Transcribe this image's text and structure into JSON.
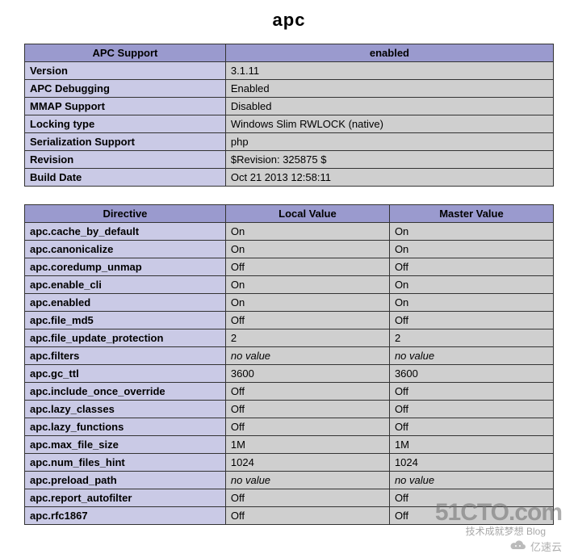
{
  "title": "apc",
  "support_table": {
    "header_left": "APC Support",
    "header_right": "enabled",
    "rows": [
      {
        "k": "Version",
        "v": "3.1.11"
      },
      {
        "k": "APC Debugging",
        "v": "Enabled"
      },
      {
        "k": "MMAP Support",
        "v": "Disabled"
      },
      {
        "k": "Locking type",
        "v": "Windows Slim RWLOCK (native)"
      },
      {
        "k": "Serialization Support",
        "v": "php"
      },
      {
        "k": "Revision",
        "v": "$Revision: 325875 $"
      },
      {
        "k": "Build Date",
        "v": "Oct 21 2013 12:58:11"
      }
    ]
  },
  "directives_table": {
    "headers": [
      "Directive",
      "Local Value",
      "Master Value"
    ],
    "rows": [
      {
        "d": "apc.cache_by_default",
        "l": "On",
        "m": "On"
      },
      {
        "d": "apc.canonicalize",
        "l": "On",
        "m": "On"
      },
      {
        "d": "apc.coredump_unmap",
        "l": "Off",
        "m": "Off"
      },
      {
        "d": "apc.enable_cli",
        "l": "On",
        "m": "On"
      },
      {
        "d": "apc.enabled",
        "l": "On",
        "m": "On"
      },
      {
        "d": "apc.file_md5",
        "l": "Off",
        "m": "Off"
      },
      {
        "d": "apc.file_update_protection",
        "l": "2",
        "m": "2"
      },
      {
        "d": "apc.filters",
        "l": "no value",
        "m": "no value",
        "nv": true
      },
      {
        "d": "apc.gc_ttl",
        "l": "3600",
        "m": "3600"
      },
      {
        "d": "apc.include_once_override",
        "l": "Off",
        "m": "Off"
      },
      {
        "d": "apc.lazy_classes",
        "l": "Off",
        "m": "Off"
      },
      {
        "d": "apc.lazy_functions",
        "l": "Off",
        "m": "Off"
      },
      {
        "d": "apc.max_file_size",
        "l": "1M",
        "m": "1M"
      },
      {
        "d": "apc.num_files_hint",
        "l": "1024",
        "m": "1024"
      },
      {
        "d": "apc.preload_path",
        "l": "no value",
        "m": "no value",
        "nv": true
      },
      {
        "d": "apc.report_autofilter",
        "l": "Off",
        "m": "Off"
      },
      {
        "d": "apc.rfc1867",
        "l": "Off",
        "m": "Off"
      }
    ]
  },
  "watermarks": {
    "a": "51CTO.com",
    "a_sub": "技术成就梦想   Blog",
    "b": "亿速云"
  }
}
